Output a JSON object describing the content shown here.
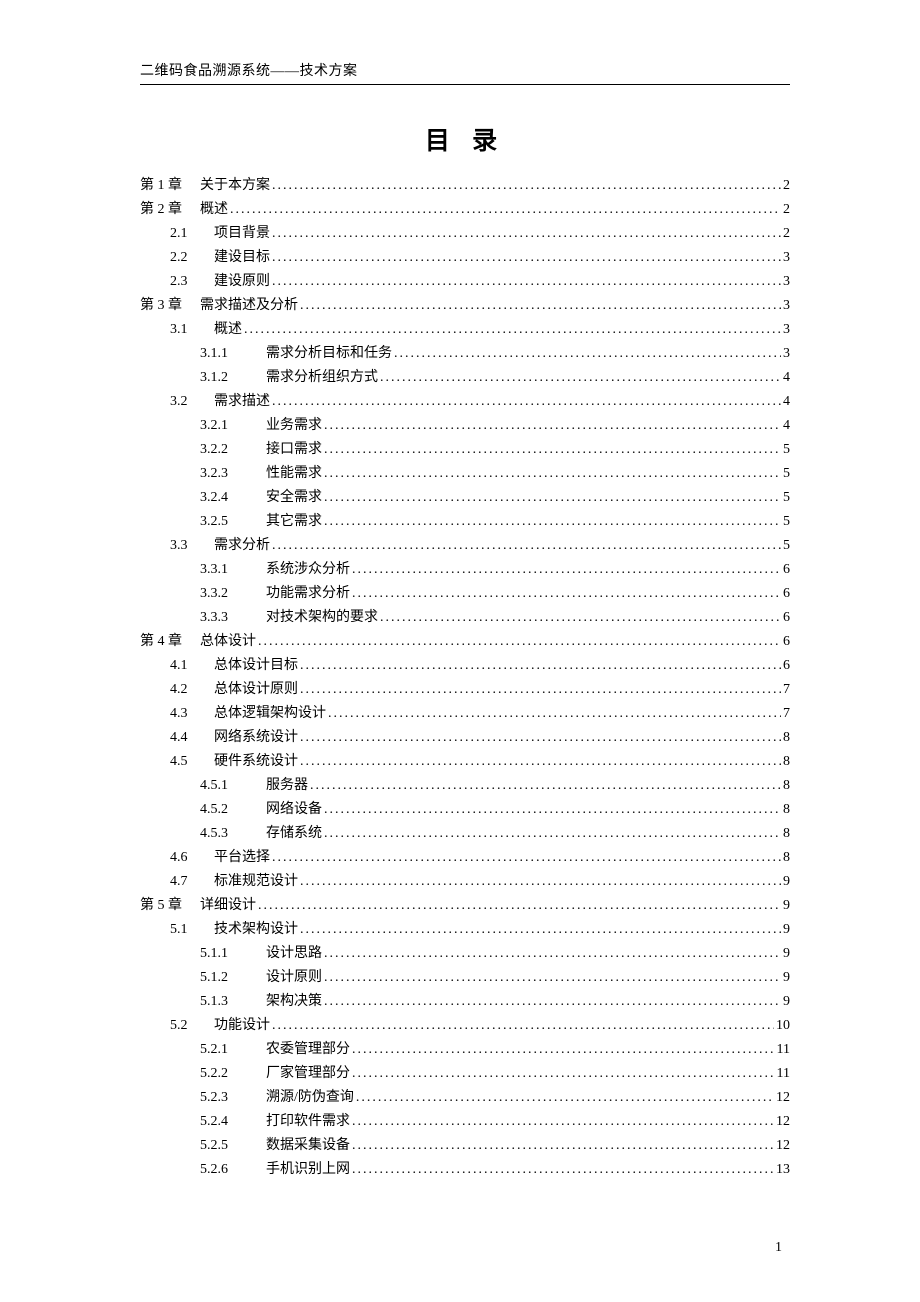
{
  "header": "二维码食品溯源系统——技术方案",
  "title": "目 录",
  "page_number": "1",
  "toc": [
    {
      "level": "chapter",
      "label": "第 1 章",
      "text": "关于本方案",
      "page": "2"
    },
    {
      "level": "chapter",
      "label": "第 2 章",
      "text": "概述",
      "page": "2"
    },
    {
      "level": "sec",
      "label": "2.1",
      "text": "项目背景",
      "page": "2"
    },
    {
      "level": "sec",
      "label": "2.2",
      "text": "建设目标",
      "page": "3"
    },
    {
      "level": "sec",
      "label": "2.3",
      "text": "建设原则",
      "page": "3"
    },
    {
      "level": "chapter",
      "label": "第 3 章",
      "text": "需求描述及分析",
      "page": "3"
    },
    {
      "level": "sec",
      "label": "3.1",
      "text": "概述",
      "page": "3"
    },
    {
      "level": "sub",
      "label": "3.1.1",
      "text": "需求分析目标和任务",
      "page": "3"
    },
    {
      "level": "sub",
      "label": "3.1.2",
      "text": "需求分析组织方式",
      "page": "4"
    },
    {
      "level": "sec",
      "label": "3.2",
      "text": "需求描述",
      "page": "4"
    },
    {
      "level": "sub",
      "label": "3.2.1",
      "text": "业务需求",
      "page": "4"
    },
    {
      "level": "sub",
      "label": "3.2.2",
      "text": "接口需求",
      "page": "5"
    },
    {
      "level": "sub",
      "label": "3.2.3",
      "text": "性能需求",
      "page": "5"
    },
    {
      "level": "sub",
      "label": "3.2.4",
      "text": "安全需求",
      "page": "5"
    },
    {
      "level": "sub",
      "label": "3.2.5",
      "text": "其它需求",
      "page": "5"
    },
    {
      "level": "sec",
      "label": "3.3",
      "text": "需求分析",
      "page": "5"
    },
    {
      "level": "sub",
      "label": "3.3.1",
      "text": "系统涉众分析",
      "page": "6"
    },
    {
      "level": "sub",
      "label": "3.3.2",
      "text": "功能需求分析",
      "page": "6"
    },
    {
      "level": "sub",
      "label": "3.3.3",
      "text": "对技术架构的要求",
      "page": "6"
    },
    {
      "level": "chapter",
      "label": "第 4 章",
      "text": "总体设计",
      "page": "6"
    },
    {
      "level": "sec",
      "label": "4.1",
      "text": "总体设计目标",
      "page": "6"
    },
    {
      "level": "sec",
      "label": "4.2",
      "text": "总体设计原则",
      "page": "7"
    },
    {
      "level": "sec",
      "label": "4.3",
      "text": "总体逻辑架构设计",
      "page": "7"
    },
    {
      "level": "sec",
      "label": "4.4",
      "text": "网络系统设计",
      "page": "8"
    },
    {
      "level": "sec",
      "label": "4.5",
      "text": "硬件系统设计",
      "page": "8"
    },
    {
      "level": "sub",
      "label": "4.5.1",
      "text": "服务器",
      "page": "8"
    },
    {
      "level": "sub",
      "label": "4.5.2",
      "text": "网络设备",
      "page": "8"
    },
    {
      "level": "sub",
      "label": "4.5.3",
      "text": "存储系统",
      "page": "8"
    },
    {
      "level": "sec",
      "label": "4.6",
      "text": "平台选择",
      "page": "8"
    },
    {
      "level": "sec",
      "label": "4.7",
      "text": "标准规范设计",
      "page": "9"
    },
    {
      "level": "chapter",
      "label": "第 5 章",
      "text": "详细设计",
      "page": "9"
    },
    {
      "level": "sec",
      "label": "5.1",
      "text": "技术架构设计",
      "page": "9"
    },
    {
      "level": "sub",
      "label": "5.1.1",
      "text": "设计思路",
      "page": "9"
    },
    {
      "level": "sub",
      "label": "5.1.2",
      "text": "设计原则",
      "page": "9"
    },
    {
      "level": "sub",
      "label": "5.1.3",
      "text": "架构决策",
      "page": "9"
    },
    {
      "level": "sec",
      "label": "5.2",
      "text": "功能设计",
      "page": "10"
    },
    {
      "level": "sub",
      "label": "5.2.1",
      "text": "农委管理部分",
      "page": "11"
    },
    {
      "level": "sub",
      "label": "5.2.2",
      "text": "厂家管理部分",
      "page": "11"
    },
    {
      "level": "sub",
      "label": "5.2.3",
      "text": "溯源/防伪查询 ",
      "page": "12"
    },
    {
      "level": "sub",
      "label": "5.2.4",
      "text": "打印软件需求",
      "page": "12"
    },
    {
      "level": "sub",
      "label": "5.2.5",
      "text": "数据采集设备",
      "page": "12"
    },
    {
      "level": "sub",
      "label": "5.2.6",
      "text": "手机识别上网",
      "page": "13"
    }
  ]
}
